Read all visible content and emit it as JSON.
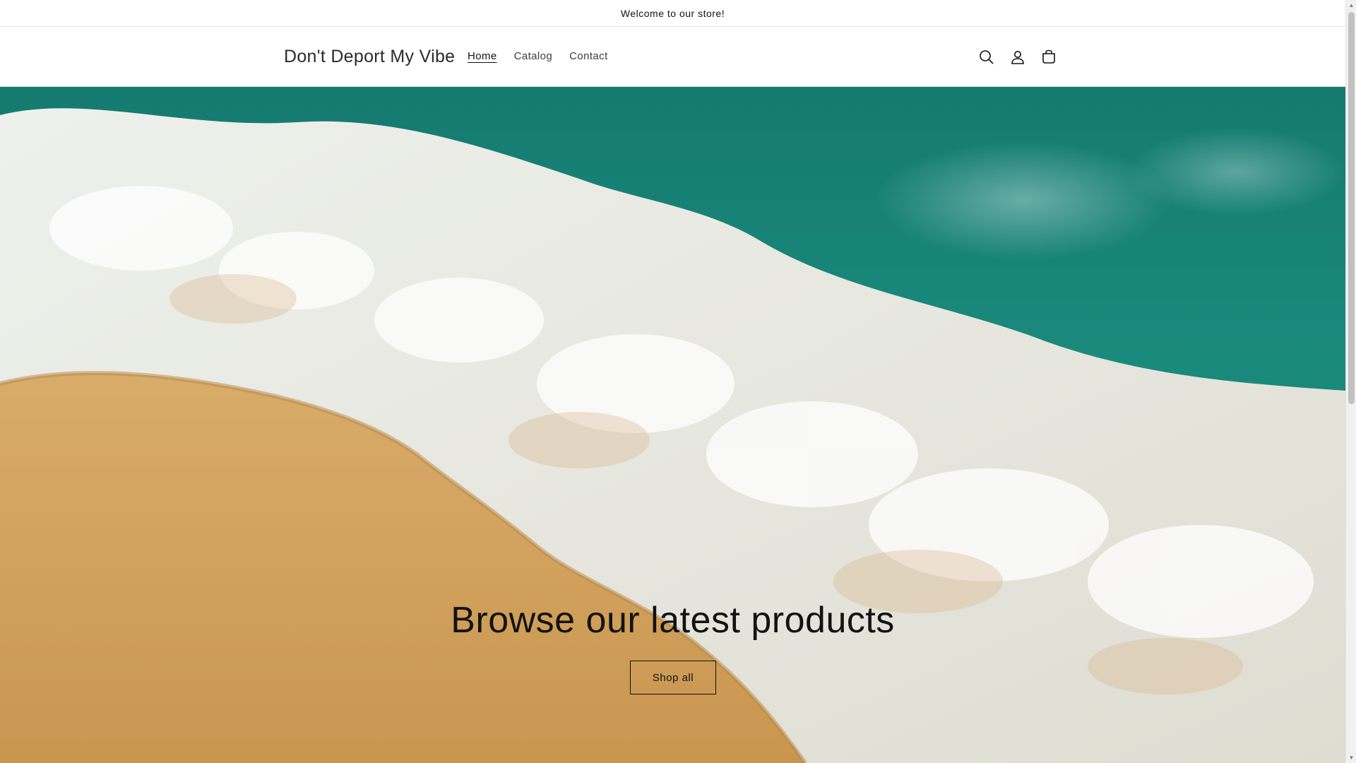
{
  "announcement": {
    "text": "Welcome to our store!"
  },
  "header": {
    "logo": "Don't Deport My Vibe",
    "nav": [
      {
        "label": "Home",
        "active": true
      },
      {
        "label": "Catalog",
        "active": false
      },
      {
        "label": "Contact",
        "active": false
      }
    ],
    "icons": [
      "search-icon",
      "account-icon",
      "cart-icon"
    ]
  },
  "hero": {
    "heading": "Browse our latest products",
    "button_label": "Shop all",
    "image": "beach-waves-photo"
  },
  "colors": {
    "text": "#121212",
    "sea": "#1a8a7d",
    "sand": "#d6a45f",
    "foam": "#f4f4f2"
  }
}
